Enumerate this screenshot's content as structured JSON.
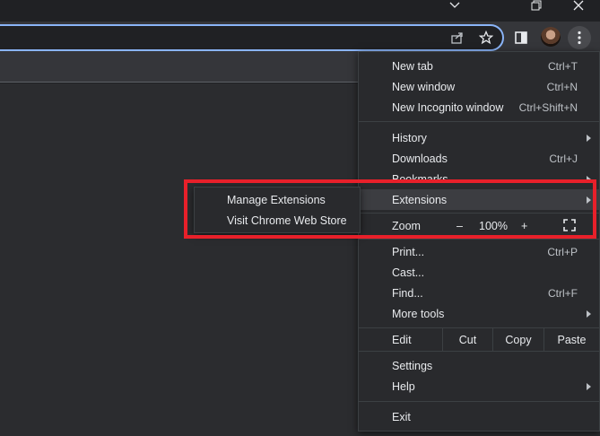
{
  "window": {
    "controls": [
      "chevron-down",
      "restore",
      "close"
    ]
  },
  "toolbar": {
    "icons": [
      "share-icon",
      "star-icon",
      "side-panel-icon",
      "avatar",
      "kebab-menu-icon"
    ]
  },
  "menu": {
    "group1": [
      {
        "label": "New tab",
        "shortcut": "Ctrl+T"
      },
      {
        "label": "New window",
        "shortcut": "Ctrl+N"
      },
      {
        "label": "New Incognito window",
        "shortcut": "Ctrl+Shift+N"
      }
    ],
    "group2": [
      {
        "label": "History",
        "shortcut": ""
      },
      {
        "label": "Downloads",
        "shortcut": "Ctrl+J"
      },
      {
        "label": "Bookmarks",
        "shortcut": ""
      },
      {
        "label": "Extensions",
        "shortcut": ""
      }
    ],
    "zoom": {
      "label": "Zoom",
      "minus": "–",
      "value": "100%",
      "plus": "+"
    },
    "group3": [
      {
        "label": "Print...",
        "shortcut": "Ctrl+P"
      },
      {
        "label": "Cast...",
        "shortcut": ""
      },
      {
        "label": "Find...",
        "shortcut": "Ctrl+F"
      },
      {
        "label": "More tools",
        "shortcut": ""
      }
    ],
    "edit": {
      "label": "Edit",
      "cut": "Cut",
      "copy": "Copy",
      "paste": "Paste"
    },
    "group4": [
      {
        "label": "Settings"
      },
      {
        "label": "Help"
      }
    ],
    "exit": {
      "label": "Exit"
    }
  },
  "submenu": {
    "items": [
      {
        "label": "Manage Extensions"
      },
      {
        "label": "Visit Chrome Web Store"
      }
    ]
  },
  "colors": {
    "highlight": "#e8202a",
    "accent": "#8ab4f8",
    "menu_bg": "#292a2d"
  }
}
